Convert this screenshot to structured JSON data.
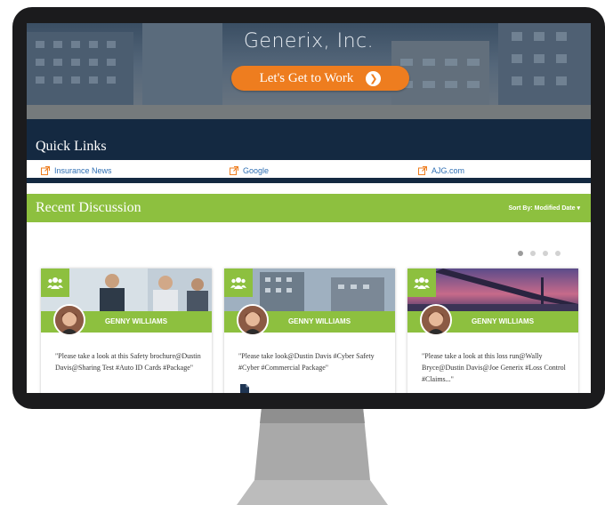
{
  "hero": {
    "company_name": "Generix, Inc.",
    "cta_label": "Let's Get to Work"
  },
  "quick_links": {
    "title": "Quick Links",
    "items": [
      {
        "label": "Insurance News"
      },
      {
        "label": "Google"
      },
      {
        "label": "AJG.com"
      }
    ]
  },
  "discussion": {
    "title": "Recent Discussion",
    "sort_label": "Sort By: Modified Date",
    "carousel_pages": 4,
    "active_page": 1,
    "cards": [
      {
        "author": "GENNY WILLIAMS",
        "text": "\"Please take a look at this Safety brochure@Dustin Davis@Sharing Test #Auto ID Cards #Package\""
      },
      {
        "author": "GENNY WILLIAMS",
        "text": "\"Please take look@Dustin Davis #Cyber Safety #Cyber #Commercial Package\""
      },
      {
        "author": "GENNY WILLIAMS",
        "text": "\"Please take a look at this loss run@Wally Bryce@Dustin Davis@Joe Generix #Loss Control #Claims...\""
      }
    ]
  },
  "colors": {
    "accent_green": "#8dc03f",
    "navy": "#142941",
    "cta_orange": "#ee7d1f",
    "link_blue": "#2f6fb3"
  },
  "icons": {
    "cta": "chevron-right-circle-icon",
    "link": "external-link-icon",
    "badge": "group-icon",
    "attachment": "document-icon"
  }
}
